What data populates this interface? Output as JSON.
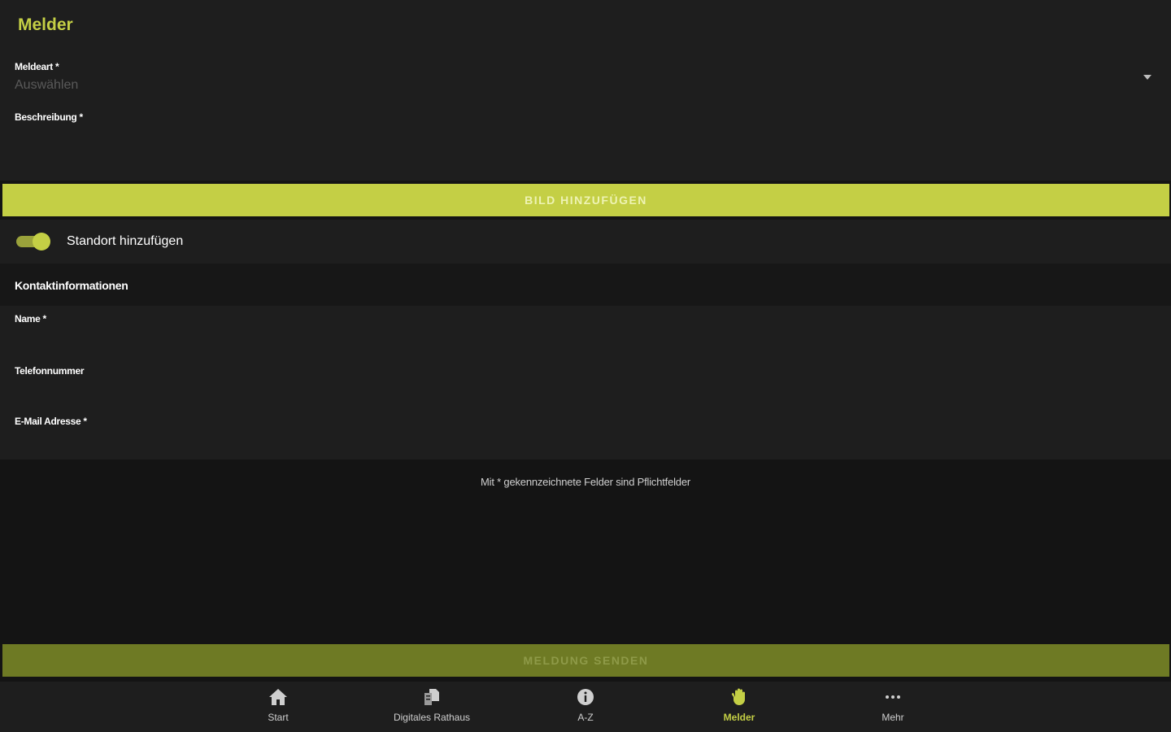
{
  "header": {
    "title": "Melder"
  },
  "form": {
    "meldeart_label": "Meldeart *",
    "meldeart_value": "Auswählen",
    "beschreibung_label": "Beschreibung *",
    "add_image_button": "BILD HINZUFÜGEN",
    "location_toggle_label": "Standort hinzufügen",
    "location_toggle_on": true
  },
  "contact": {
    "section_title": "Kontaktinformationen",
    "name_label": "Name *",
    "phone_label": "Telefonnummer",
    "email_label": "E-Mail Adresse *"
  },
  "note": "Mit * gekennzeichnete Felder sind Pflichtfelder",
  "send_button": "MELDUNG SENDEN",
  "nav": {
    "items": [
      {
        "label": "Start",
        "icon": "home-icon"
      },
      {
        "label": "Digitales Rathaus",
        "icon": "documents-icon"
      },
      {
        "label": "A-Z",
        "icon": "info-icon"
      },
      {
        "label": "Melder",
        "icon": "hand-icon",
        "active": true
      },
      {
        "label": "Mehr",
        "icon": "more-icon"
      }
    ]
  },
  "colors": {
    "accent": "#c4cf45",
    "background": "#141414",
    "surface": "#1e1e1e"
  }
}
